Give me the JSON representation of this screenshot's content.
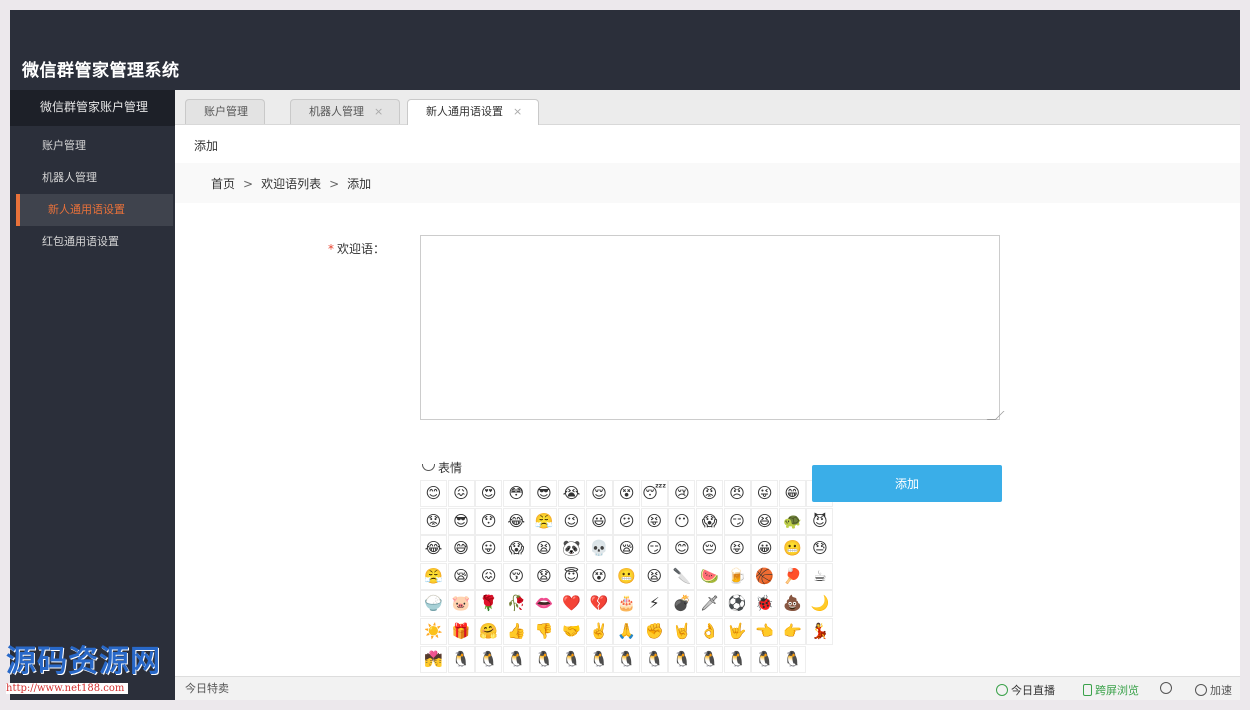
{
  "app": {
    "title": "微信群管家管理系统"
  },
  "sidebar": {
    "header": "微信群管家账户管理",
    "items": [
      {
        "label": "账户管理"
      },
      {
        "label": "机器人管理"
      },
      {
        "label": "新人通用语设置",
        "active": true
      },
      {
        "label": "红包通用语设置"
      }
    ]
  },
  "tabs": [
    {
      "label": "账户管理"
    },
    {
      "label": "机器人管理",
      "close": "×"
    },
    {
      "label": "新人通用语设置",
      "close": "×",
      "active": true
    }
  ],
  "page": {
    "section": "添加",
    "breadcrumb": {
      "home": "首页",
      "list": "欢迎语列表",
      "current": "添加",
      "separator": ">"
    }
  },
  "form": {
    "required_mark": "*",
    "welcome_label": "欢迎语：",
    "welcome_value": "",
    "emoji_label": "表情",
    "submit_label": "添加"
  },
  "emojis": [
    "😊",
    "😖",
    "😍",
    "😳",
    "😎",
    "😭",
    "😌",
    "😵",
    "😴",
    "😢",
    "😡",
    "😠",
    "😜",
    "😁",
    "😲",
    "😟",
    "😎",
    "😯",
    "😂",
    "😤",
    "😉",
    "😃",
    "😕",
    "😝",
    "😶",
    "😱",
    "😏",
    "😆",
    "🐢",
    "😈",
    "😂",
    "😅",
    "😛",
    "😱",
    "😫",
    "🐼",
    "💀",
    "😪",
    "😏",
    "😊",
    "😔",
    "😝",
    "😀",
    "😬",
    "😓",
    "😤",
    "😪",
    "😖",
    "😚",
    "😧",
    "😇",
    "😵",
    "😬",
    "😫",
    "🔪",
    "🍉",
    "🍺",
    "🏀",
    "🏓",
    "☕",
    "🍚",
    "🐷",
    "🌹",
    "🥀",
    "👄",
    "❤️",
    "💔",
    "🎂",
    "⚡",
    "💣",
    "🗡",
    "⚽",
    "🐞",
    "💩",
    "🌙",
    "☀️",
    "🎁",
    "🤗",
    "👍",
    "👎",
    "🤝",
    "✌️",
    "🙏",
    "✊",
    "🤘",
    "👌",
    "🤟",
    "👈",
    "👉",
    "💃",
    "💏",
    "🐧",
    "🐧",
    "🐧",
    "🐧",
    "🐧",
    "🐧",
    "🐧",
    "🐧",
    "🐧",
    "🐧",
    "🐧",
    "🐧",
    "🐧"
  ],
  "footer": {
    "left": "今日特卖",
    "live": "今日直播",
    "screen": "跨屏浏览",
    "speed": "加速"
  },
  "watermark": {
    "title": "源码资源网",
    "url": "http://www.net188.com"
  },
  "colors": {
    "header_bg": "#2b2f3a",
    "accent_orange": "#e8713a",
    "button_blue": "#3aaee8",
    "live_green": "#3aa24a"
  }
}
